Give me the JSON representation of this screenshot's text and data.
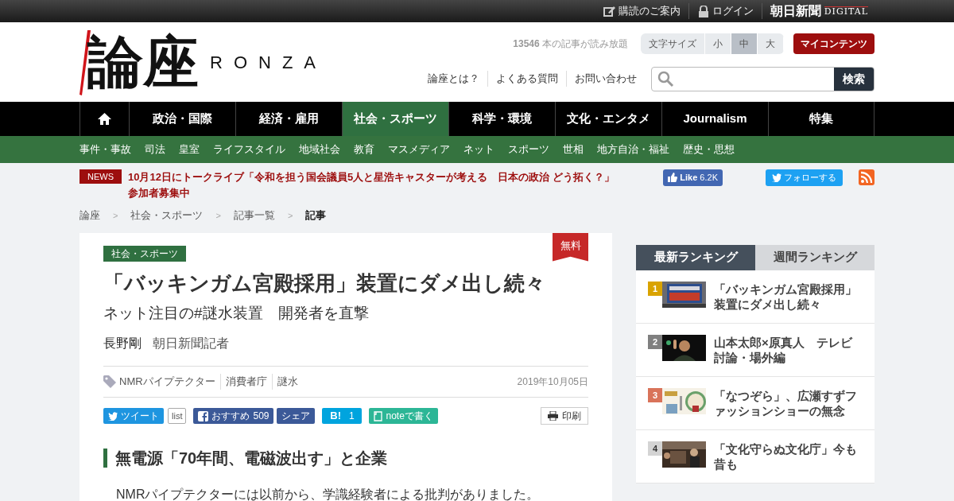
{
  "top_bar": {
    "links": [
      {
        "kind": "edit",
        "label": "購読のご案内"
      },
      {
        "kind": "lock",
        "label": "ログイン"
      }
    ],
    "brand": "朝日新聞",
    "brand_sub": "DIGITAL"
  },
  "header": {
    "logo": {
      "main": "論座",
      "sub": "RONZA"
    },
    "article_count": {
      "number": "13546",
      "text": "本の記事が読み放題"
    },
    "font_size": {
      "label": "文字サイズ",
      "options": [
        {
          "label": "小",
          "selected": false
        },
        {
          "label": "中",
          "selected": true
        },
        {
          "label": "大",
          "selected": false
        }
      ]
    },
    "my_contents": "マイコンテンツ",
    "links": [
      "論座とは？",
      "よくある質問",
      "お問い合わせ"
    ],
    "search": {
      "button": "検索"
    }
  },
  "nav": [
    {
      "kind": "home",
      "selected": false
    },
    {
      "kind": "text",
      "label": "政治・国際",
      "selected": false
    },
    {
      "kind": "text",
      "label": "経済・雇用",
      "selected": false
    },
    {
      "kind": "text",
      "label": "社会・スポーツ",
      "selected": true
    },
    {
      "kind": "text",
      "label": "科学・環境",
      "selected": false
    },
    {
      "kind": "text",
      "label": "文化・エンタメ",
      "selected": false
    },
    {
      "kind": "text",
      "label": "Journalism",
      "selected": false
    },
    {
      "kind": "text",
      "label": "特集",
      "selected": false
    }
  ],
  "subnav": [
    "事件・事故",
    "司法",
    "皇室",
    "ライフスタイル",
    "地域社会",
    "教育",
    "マスメディア",
    "ネット",
    "スポーツ",
    "世相",
    "地方自治・福祉",
    "歴史・思想"
  ],
  "news": {
    "badge": "NEWS",
    "text": "10月12日にトークライブ「令和を担う国会議員5人と星浩キャスターが考える　日本の政治 どう拓く？」参加者募集中"
  },
  "social": {
    "like": "Like",
    "like_count": "6.2K",
    "follow": "フォローする"
  },
  "breadcrumb": [
    {
      "label": "論座",
      "current": false
    },
    {
      "label": "社会・スポーツ",
      "current": false
    },
    {
      "label": "記事一覧",
      "current": false
    },
    {
      "label": "記事",
      "current": true
    }
  ],
  "breadcrumb_separator": ">",
  "article": {
    "category": "社会・スポーツ",
    "free_badge": "無料",
    "title": "「バッキンガム宮殿採用」装置にダメ出し続々",
    "subtitle": "ネット注目の#謎水装置　開発者を直撃",
    "author": "長野剛",
    "author_role": "朝日新聞記者",
    "tags": [
      "NMRパイプテクター",
      "消費者庁",
      "謎水"
    ],
    "date": "2019年10月05日",
    "share": [
      {
        "kind": "tweet",
        "label": "ツイート"
      },
      {
        "kind": "bubble",
        "label": "list"
      },
      {
        "kind": "facebook",
        "label": "おすすめ",
        "count": "509"
      },
      {
        "kind": "share",
        "label": "シェア"
      },
      {
        "kind": "hatena",
        "label": "B!",
        "count": "1"
      },
      {
        "kind": "note",
        "label": "noteで書く"
      }
    ],
    "print": "印刷",
    "heading": "無電源「70年間、電磁波出す」と企業",
    "body": "NMRパイプテクターには以前から、学識経験者による批判がありました。"
  },
  "ranking": {
    "tabs": [
      {
        "label": "最新ランキング",
        "selected": true
      },
      {
        "label": "週間ランキング",
        "selected": false
      }
    ],
    "items": [
      {
        "rank": "1",
        "color": "#d9a300",
        "title": "「バッキンガム宮殿採用」装置にダメ出し続々"
      },
      {
        "rank": "2",
        "color": "#808080",
        "title": "山本太郎×原真人　テレビ討論・場外編"
      },
      {
        "rank": "3",
        "color": "#d9735a",
        "title": "「なつぞら」、広瀬すずファッションショーの無念"
      },
      {
        "rank": "4",
        "color": "#d4d4d4",
        "title": "「文化守らぬ文化庁」今も昔も"
      }
    ]
  }
}
